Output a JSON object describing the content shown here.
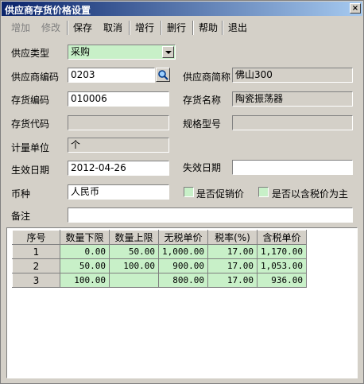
{
  "window": {
    "title": "供应商存货价格设置",
    "close_glyph": "×"
  },
  "toolbar": {
    "add": "增加",
    "edit": "修改",
    "save": "保存",
    "cancel": "取消",
    "add_row": "增行",
    "delete_row": "删行",
    "help": "帮助",
    "exit": "退出"
  },
  "form": {
    "supply_type": {
      "label": "供应类型",
      "value": "采购"
    },
    "vendor_code": {
      "label": "供应商编码",
      "value": "0203"
    },
    "vendor_short_name": {
      "label": "供应商简称",
      "value": "佛山300"
    },
    "item_code": {
      "label": "存货编码",
      "value": "010006"
    },
    "item_name": {
      "label": "存货名称",
      "value": "陶瓷振荡器"
    },
    "item_alias": {
      "label": "存货代码",
      "value": ""
    },
    "spec": {
      "label": "规格型号",
      "value": ""
    },
    "unit": {
      "label": "计量单位",
      "value": "个"
    },
    "effective_date": {
      "label": "生效日期",
      "value": "2012-04-26"
    },
    "expire_date": {
      "label": "失效日期",
      "value": ""
    },
    "currency": {
      "label": "币种",
      "value": "人民币"
    },
    "is_promo": {
      "label": "是否促销价"
    },
    "tax_inclusive_main": {
      "label": "是否以含税价为主"
    },
    "remark": {
      "label": "备注",
      "value": ""
    }
  },
  "grid": {
    "columns": [
      "序号",
      "数量下限",
      "数量上限",
      "无税单价",
      "税率(%)",
      "含税单价"
    ],
    "rows": [
      [
        "1",
        "0.00",
        "50.00",
        "1,000.00",
        "17.00",
        "1,170.00"
      ],
      [
        "2",
        "50.00",
        "100.00",
        "900.00",
        "17.00",
        "1,053.00"
      ],
      [
        "3",
        "100.00",
        "",
        "800.00",
        "17.00",
        "936.00"
      ]
    ]
  }
}
